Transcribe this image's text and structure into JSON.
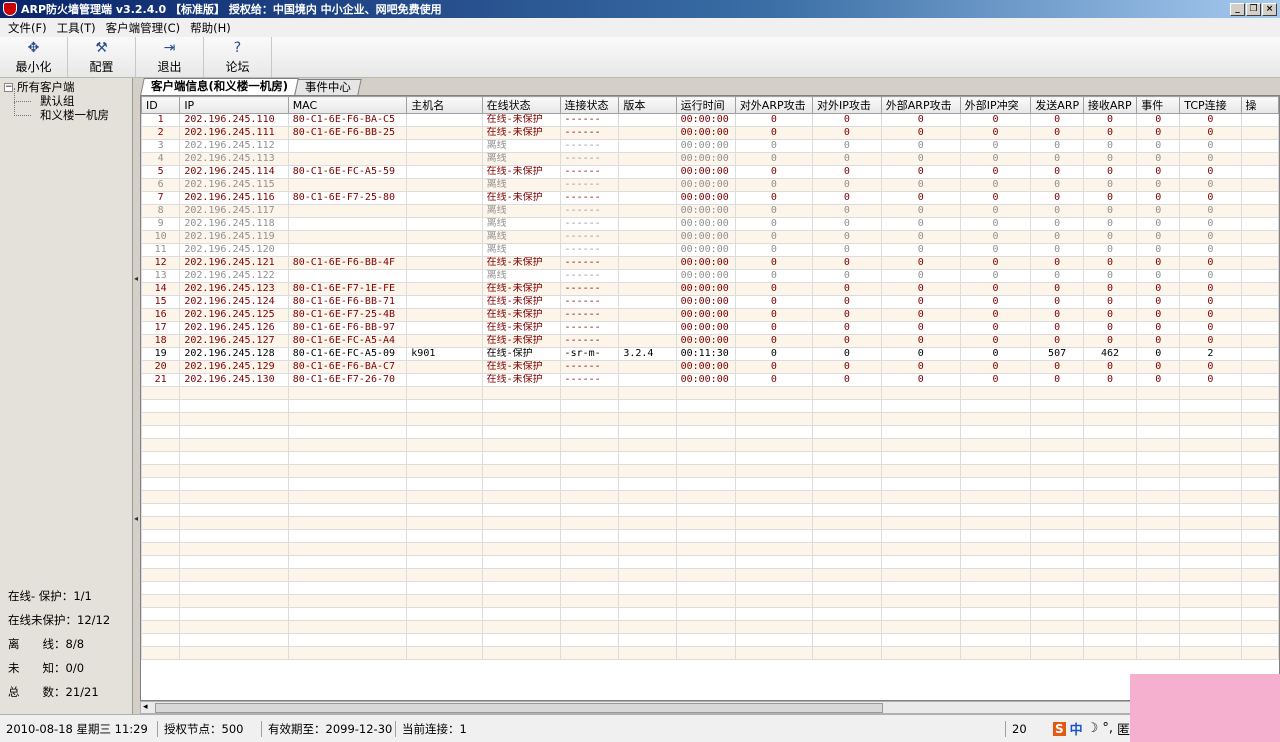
{
  "window": {
    "title": "ARP防火墙管理端 v3.2.4.0 【标准版】 授权给：中国境内 中小企业、网吧免费使用"
  },
  "menu": [
    "文件(F)",
    "工具(T)",
    "客户端管理(C)",
    "帮助(H)"
  ],
  "toolbar": [
    {
      "label": "最小化",
      "icon": "minimize-icon"
    },
    {
      "label": "配置",
      "icon": "config-icon"
    },
    {
      "label": "退出",
      "icon": "exit-icon"
    },
    {
      "label": "论坛",
      "icon": "help-icon"
    }
  ],
  "tree": {
    "root": "所有客户端",
    "children": [
      "默认组",
      "和义楼一机房"
    ]
  },
  "stats": [
    {
      "label": "在线- 保护：",
      "value": "1/1"
    },
    {
      "label": "在线未保护：",
      "value": "12/12"
    },
    {
      "label": "离　　线：",
      "value": "8/8"
    },
    {
      "label": "未　　知：",
      "value": "0/0"
    },
    {
      "label": "总　　数：",
      "value": "21/21"
    }
  ],
  "tabs": [
    "客户端信息(和义楼一机房)",
    "事件中心"
  ],
  "columns": [
    "ID",
    "IP",
    "MAC",
    "主机名",
    "在线状态",
    "连接状态",
    "版本",
    "运行时间",
    "对外ARP攻击",
    "对外IP攻击",
    "外部ARP攻击",
    "外部IP冲突",
    "发送ARP",
    "接收ARP",
    "事件",
    "TCP连接",
    "操"
  ],
  "rows": [
    {
      "state": "online",
      "c": [
        "1",
        "202.196.245.110",
        "80-C1-6E-F6-BA-C5",
        "",
        "在线-未保护",
        "------",
        "",
        "00:00:00",
        "0",
        "0",
        "0",
        "0",
        "0",
        "0",
        "0",
        "0"
      ]
    },
    {
      "state": "online",
      "c": [
        "2",
        "202.196.245.111",
        "80-C1-6E-F6-BB-25",
        "",
        "在线-未保护",
        "------",
        "",
        "00:00:00",
        "0",
        "0",
        "0",
        "0",
        "0",
        "0",
        "0",
        "0"
      ]
    },
    {
      "state": "offline",
      "c": [
        "3",
        "202.196.245.112",
        "",
        "",
        "离线",
        "------",
        "",
        "00:00:00",
        "0",
        "0",
        "0",
        "0",
        "0",
        "0",
        "0",
        "0"
      ]
    },
    {
      "state": "offline",
      "c": [
        "4",
        "202.196.245.113",
        "",
        "",
        "离线",
        "------",
        "",
        "00:00:00",
        "0",
        "0",
        "0",
        "0",
        "0",
        "0",
        "0",
        "0"
      ]
    },
    {
      "state": "online",
      "c": [
        "5",
        "202.196.245.114",
        "80-C1-6E-FC-A5-59",
        "",
        "在线-未保护",
        "------",
        "",
        "00:00:00",
        "0",
        "0",
        "0",
        "0",
        "0",
        "0",
        "0",
        "0"
      ]
    },
    {
      "state": "offline",
      "c": [
        "6",
        "202.196.245.115",
        "",
        "",
        "离线",
        "------",
        "",
        "00:00:00",
        "0",
        "0",
        "0",
        "0",
        "0",
        "0",
        "0",
        "0"
      ]
    },
    {
      "state": "online",
      "c": [
        "7",
        "202.196.245.116",
        "80-C1-6E-F7-25-80",
        "",
        "在线-未保护",
        "------",
        "",
        "00:00:00",
        "0",
        "0",
        "0",
        "0",
        "0",
        "0",
        "0",
        "0"
      ]
    },
    {
      "state": "offline",
      "c": [
        "8",
        "202.196.245.117",
        "",
        "",
        "离线",
        "------",
        "",
        "00:00:00",
        "0",
        "0",
        "0",
        "0",
        "0",
        "0",
        "0",
        "0"
      ]
    },
    {
      "state": "offline",
      "c": [
        "9",
        "202.196.245.118",
        "",
        "",
        "离线",
        "------",
        "",
        "00:00:00",
        "0",
        "0",
        "0",
        "0",
        "0",
        "0",
        "0",
        "0"
      ]
    },
    {
      "state": "offline",
      "c": [
        "10",
        "202.196.245.119",
        "",
        "",
        "离线",
        "------",
        "",
        "00:00:00",
        "0",
        "0",
        "0",
        "0",
        "0",
        "0",
        "0",
        "0"
      ]
    },
    {
      "state": "offline",
      "c": [
        "11",
        "202.196.245.120",
        "",
        "",
        "离线",
        "------",
        "",
        "00:00:00",
        "0",
        "0",
        "0",
        "0",
        "0",
        "0",
        "0",
        "0"
      ]
    },
    {
      "state": "online",
      "c": [
        "12",
        "202.196.245.121",
        "80-C1-6E-F6-BB-4F",
        "",
        "在线-未保护",
        "------",
        "",
        "00:00:00",
        "0",
        "0",
        "0",
        "0",
        "0",
        "0",
        "0",
        "0"
      ]
    },
    {
      "state": "offline",
      "c": [
        "13",
        "202.196.245.122",
        "",
        "",
        "离线",
        "------",
        "",
        "00:00:00",
        "0",
        "0",
        "0",
        "0",
        "0",
        "0",
        "0",
        "0"
      ]
    },
    {
      "state": "online",
      "c": [
        "14",
        "202.196.245.123",
        "80-C1-6E-F7-1E-FE",
        "",
        "在线-未保护",
        "------",
        "",
        "00:00:00",
        "0",
        "0",
        "0",
        "0",
        "0",
        "0",
        "0",
        "0"
      ]
    },
    {
      "state": "online",
      "c": [
        "15",
        "202.196.245.124",
        "80-C1-6E-F6-BB-71",
        "",
        "在线-未保护",
        "------",
        "",
        "00:00:00",
        "0",
        "0",
        "0",
        "0",
        "0",
        "0",
        "0",
        "0"
      ]
    },
    {
      "state": "online",
      "c": [
        "16",
        "202.196.245.125",
        "80-C1-6E-F7-25-4B",
        "",
        "在线-未保护",
        "------",
        "",
        "00:00:00",
        "0",
        "0",
        "0",
        "0",
        "0",
        "0",
        "0",
        "0"
      ]
    },
    {
      "state": "online",
      "c": [
        "17",
        "202.196.245.126",
        "80-C1-6E-F6-BB-97",
        "",
        "在线-未保护",
        "------",
        "",
        "00:00:00",
        "0",
        "0",
        "0",
        "0",
        "0",
        "0",
        "0",
        "0"
      ]
    },
    {
      "state": "online",
      "c": [
        "18",
        "202.196.245.127",
        "80-C1-6E-FC-A5-A4",
        "",
        "在线-未保护",
        "------",
        "",
        "00:00:00",
        "0",
        "0",
        "0",
        "0",
        "0",
        "0",
        "0",
        "0"
      ]
    },
    {
      "state": "protected",
      "c": [
        "19",
        "202.196.245.128",
        "80-C1-6E-FC-A5-09",
        "k901",
        "在线-保护",
        "-sr-m-",
        "3.2.4",
        "00:11:30",
        "0",
        "0",
        "0",
        "0",
        "507",
        "462",
        "0",
        "2"
      ]
    },
    {
      "state": "online",
      "c": [
        "20",
        "202.196.245.129",
        "80-C1-6E-F6-BA-C7",
        "",
        "在线-未保护",
        "------",
        "",
        "00:00:00",
        "0",
        "0",
        "0",
        "0",
        "0",
        "0",
        "0",
        "0"
      ]
    },
    {
      "state": "online",
      "c": [
        "21",
        "202.196.245.130",
        "80-C1-6E-F7-26-70",
        "",
        "在线-未保护",
        "------",
        "",
        "00:00:00",
        "0",
        "0",
        "0",
        "0",
        "0",
        "0",
        "0",
        "0"
      ]
    }
  ],
  "status": {
    "datetime": "2010-08-18 星期三 11:29",
    "nodes": "授权节点：500",
    "expiry": "有效期至：2099-12-30",
    "connections": "当前连接：1",
    "extra": "20"
  },
  "ime": {
    "logo": "S",
    "mode": "中",
    "moon": "☽",
    "punct": "°,",
    "grid": "匿"
  },
  "colors": {
    "online_unprotected": "#800000",
    "offline": "#909090",
    "title_bg": "#0a246a"
  }
}
